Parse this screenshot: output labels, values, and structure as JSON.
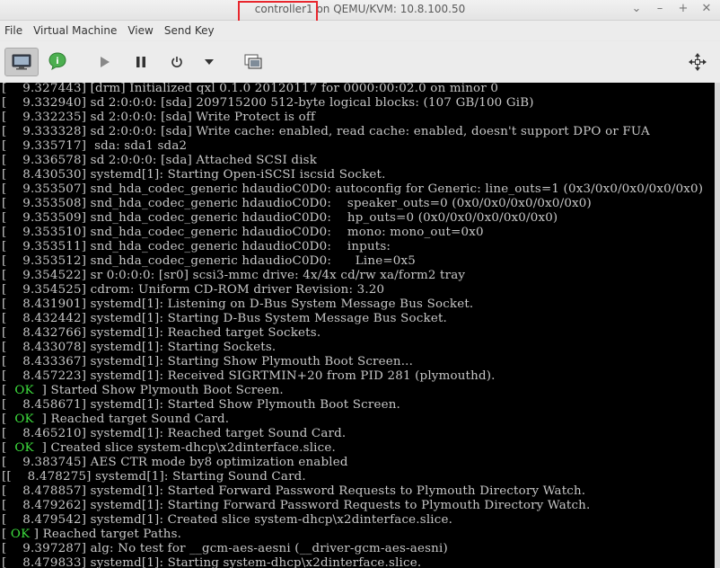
{
  "window": {
    "title_highlighted": "controller1",
    "title_rest": " on QEMU/KVM: 10.8.100.50",
    "controls": [
      "⌄",
      "–",
      "+",
      "✕"
    ]
  },
  "menu": [
    "File",
    "Virtual Machine",
    "View",
    "Send Key"
  ],
  "toolbar": {
    "buttons": [
      {
        "name": "console-view-button",
        "icon": "monitor-icon",
        "active": true
      },
      {
        "name": "details-view-button",
        "icon": "info-bubble-icon"
      },
      {
        "name": "run-button",
        "icon": "play-icon"
      },
      {
        "name": "pause-button",
        "icon": "pause-icon"
      },
      {
        "name": "shutdown-button",
        "icon": "power-icon"
      },
      {
        "name": "shutdown-menu-button",
        "icon": "caret-down-icon"
      },
      {
        "name": "snapshots-button",
        "icon": "snapshot-icon"
      },
      {
        "name": "fullscreen-button",
        "icon": "move-arrows-icon"
      }
    ]
  },
  "console_lines": [
    {
      "pre": "[    9.327443] [drm] Initialized qxl 0.1.0 20120117 for 0000:00:02.0 on minor 0"
    },
    {
      "pre": "[    9.332940] sd 2:0:0:0: [sda] 209715200 512-byte logical blocks: (107 GB/100 GiB)"
    },
    {
      "pre": "[    9.332235] sd 2:0:0:0: [sda] Write Protect is off"
    },
    {
      "pre": "[    9.333328] sd 2:0:0:0: [sda] Write cache: enabled, read cache: enabled, doesn't support DPO or FUA"
    },
    {
      "pre": "[    9.335717]  sda: sda1 sda2"
    },
    {
      "pre": "[    9.336578] sd 2:0:0:0: [sda] Attached SCSI disk"
    },
    {
      "pre": "[    8.430530] systemd[1]: Starting Open-iSCSI iscsid Socket."
    },
    {
      "pre": "[    9.353507] snd_hda_codec_generic hdaudioC0D0: autoconfig for Generic: line_outs=1 (0x3/0x0/0x0/0x0/0x0)"
    },
    {
      "pre": "[    9.353508] snd_hda_codec_generic hdaudioC0D0:    speaker_outs=0 (0x0/0x0/0x0/0x0/0x0)"
    },
    {
      "pre": "[    9.353509] snd_hda_codec_generic hdaudioC0D0:    hp_outs=0 (0x0/0x0/0x0/0x0/0x0)"
    },
    {
      "pre": "[    9.353510] snd_hda_codec_generic hdaudioC0D0:    mono: mono_out=0x0"
    },
    {
      "pre": "[    9.353511] snd_hda_codec_generic hdaudioC0D0:    inputs:"
    },
    {
      "pre": "[    9.353512] snd_hda_codec_generic hdaudioC0D0:      Line=0x5"
    },
    {
      "pre": "[    9.354522] sr 0:0:0:0: [sr0] scsi3-mmc drive: 4x/4x cd/rw xa/form2 tray"
    },
    {
      "pre": "[    9.354525] cdrom: Uniform CD-ROM driver Revision: 3.20"
    },
    {
      "pre": "[    8.431901] systemd[1]: Listening on D-Bus System Message Bus Socket."
    },
    {
      "pre": "[    8.432442] systemd[1]: Starting D-Bus System Message Bus Socket."
    },
    {
      "pre": "[    8.432766] systemd[1]: Reached target Sockets."
    },
    {
      "pre": "[    8.433078] systemd[1]: Starting Sockets."
    },
    {
      "pre": "[    8.433367] systemd[1]: Starting Show Plymouth Boot Screen..."
    },
    {
      "pre": "[    8.457223] systemd[1]: Received SIGRTMIN+20 from PID 281 (plymouthd)."
    },
    {
      "pre": "[  ",
      "ok": "OK",
      "post": "  ] Started Show Plymouth Boot Screen."
    },
    {
      "pre": "[    8.458671] systemd[1]: Started Show Plymouth Boot Screen."
    },
    {
      "pre": "[  ",
      "ok": "OK",
      "post": "  ] Reached target Sound Card."
    },
    {
      "pre": "[    8.465210] systemd[1]: Reached target Sound Card."
    },
    {
      "pre": "[  ",
      "ok": "OK",
      "post": "  ] Created slice system-dhcp\\x2dinterface.slice."
    },
    {
      "pre": "[    9.383745] AES CTR mode by8 optimization enabled"
    },
    {
      "pre": "[[    8.478275] systemd[1]: Starting Sound Card."
    },
    {
      "pre": "[    8.478857] systemd[1]: Started Forward Password Requests to Plymouth Directory Watch."
    },
    {
      "pre": "[    8.479262] systemd[1]: Starting Forward Password Requests to Plymouth Directory Watch."
    },
    {
      "pre": "[    8.479542] systemd[1]: Created slice system-dhcp\\x2dinterface.slice."
    },
    {
      "pre": "[ ",
      "ok": "OK",
      "post": " ] Reached target Paths."
    },
    {
      "pre": "[    9.397287] alg: No test for __gcm-aes-aesni (__driver-gcm-aes-aesni)"
    },
    {
      "pre": "[    8.479833] systemd[1]: Starting system-dhcp\\x2dinterface.slice."
    }
  ]
}
